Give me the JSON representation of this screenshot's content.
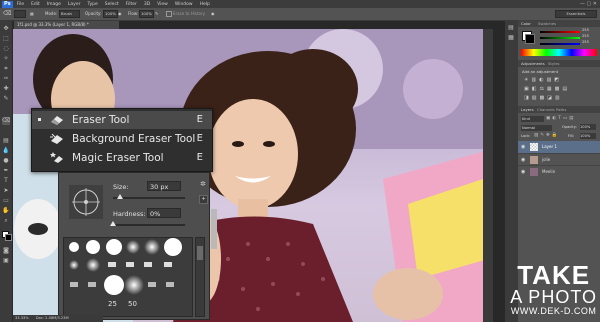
{
  "menubar": {
    "app_badge": "Ps",
    "items": [
      "File",
      "Edit",
      "Image",
      "Layer",
      "Type",
      "Select",
      "Filter",
      "3D",
      "View",
      "Window",
      "Help"
    ]
  },
  "options_bar": {
    "mode_label": "Mode:",
    "mode_value": "Brush",
    "opacity_label": "Opacity:",
    "opacity_value": "100%",
    "flow_label": "Flow:",
    "flow_value": "100%",
    "erase_history_label": "Erase to History",
    "workspace": "Essentials"
  },
  "document": {
    "tab_title": "1f1.psd @ 33.3% (Layer 1, RGB/8) *",
    "zoom_status": "33.33%",
    "doc_size": "Doc: 2.08M/5.23M"
  },
  "flyout": {
    "items": [
      {
        "label": "Eraser Tool",
        "key": "E",
        "selected": true,
        "icon": "eraser-icon"
      },
      {
        "label": "Background Eraser Tool",
        "key": "E",
        "selected": false,
        "icon": "background-eraser-icon"
      },
      {
        "label": "Magic Eraser Tool",
        "key": "E",
        "selected": false,
        "icon": "magic-eraser-icon"
      }
    ]
  },
  "brush_picker": {
    "size_label": "Size:",
    "size_value": "30 px",
    "hardness_label": "Hardness:",
    "hardness_value": "0%",
    "size_level": 0.1,
    "hardness_level": 0.0,
    "preset_sizes": [
      "25",
      "50"
    ]
  },
  "right_panel": {
    "color_tabs": [
      "Color",
      "Swatches"
    ],
    "color_values": {
      "r": "255",
      "g": "255",
      "b": "255"
    },
    "adjust_tabs": [
      "Adjustments",
      "Styles"
    ],
    "adjust_hint": "Add an adjustment",
    "layer_tabs": [
      "Layers",
      "Channels",
      "Paths"
    ],
    "kind_label": "Kind",
    "blend_mode": "Normal",
    "opacity_label": "Opacity:",
    "opacity_value": "100%",
    "lock_label": "Lock:",
    "fill_label": "Fill:",
    "fill_value": "100%",
    "layers": [
      {
        "name": "Layer 1",
        "selected": true
      },
      {
        "name": "jolie",
        "selected": false
      },
      {
        "name": "Meelin",
        "selected": false
      }
    ]
  },
  "watermark": {
    "line1": "TAKE",
    "line2": "A PHOTO",
    "line3": "WWW.DEK-D.COM"
  },
  "colors": {
    "ui_dark": "#282828",
    "ui_panel": "#535353",
    "accent": "#2b6fd6",
    "dress": "#6b1f2c"
  }
}
